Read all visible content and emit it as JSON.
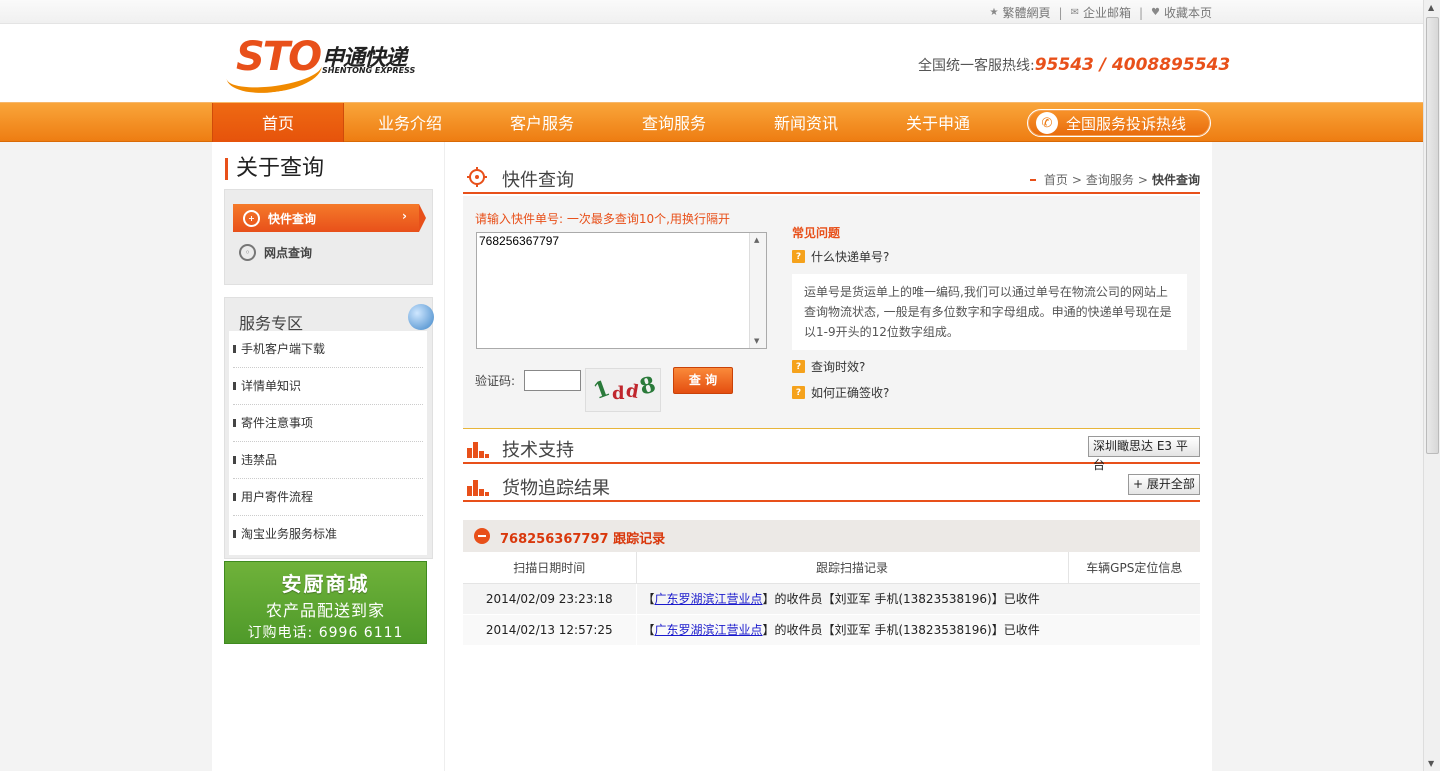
{
  "topbar": {
    "links": [
      {
        "icon": "star-icon",
        "label": "繁體網頁"
      },
      {
        "icon": "mail-icon",
        "label": "企业邮箱"
      },
      {
        "icon": "heart-icon",
        "label": "收藏本页"
      }
    ],
    "separator": "|"
  },
  "header": {
    "logo_mark": "STO",
    "logo_cn": "申通快递",
    "logo_en": "SHENTONG EXPRESS",
    "hotline_label": "全国统一客服热线:",
    "hotline_number": "95543 / 4008895543"
  },
  "nav": {
    "items": [
      "首页",
      "业务介绍",
      "客户服务",
      "查询服务",
      "新闻资讯",
      "关于申通"
    ],
    "complaint_label": "全国服务投诉热线"
  },
  "sidebar": {
    "title": "关于查询",
    "menu": [
      {
        "label": "快件查询",
        "icon": "crosshair-icon",
        "active": true
      },
      {
        "label": "网点查询",
        "icon": "location-icon",
        "active": false
      }
    ],
    "service_title": "服务专区",
    "service_items": [
      "手机客户端下载",
      "详情单知识",
      "寄件注意事项",
      "违禁品",
      "用户寄件流程",
      "淘宝业务服务标准"
    ],
    "ad": {
      "line1": "安厨商城",
      "line2": "农产品配送到家",
      "line3": "订购电话: 6996 6111"
    }
  },
  "main": {
    "section_title": "快件查询",
    "breadcrumb": [
      "首页",
      "查询服务",
      "快件查询"
    ],
    "breadcrumb_sep": ">",
    "query_hint": "请输入快件单号: 一次最多查询10个,用换行隔开",
    "tracking_input": "768256367797",
    "captcha_label": "验证码:",
    "captcha_value": "",
    "captcha_chars": [
      "1",
      "d",
      "d",
      "8"
    ],
    "query_button": "查 询",
    "faq_title": "常见问题",
    "faq": [
      "什么快递单号?",
      "查询时效?",
      "如何正确签收?"
    ],
    "faq_answer": "运单号是货运单上的唯一编码,我们可以通过单号在物流公司的网站上查询物流状态, 一般是有多位数字和字母组成。申通的快递单号现在是以1-9开头的12位数字组成。",
    "tech_title": "技术支持",
    "tech_button": "深圳瞰思达 E3 平台",
    "result_title": "货物追踪结果",
    "expand_button": "+ 展开全部",
    "track_heading": "768256367797 跟踪记录",
    "table_headers": [
      "扫描日期时间",
      "跟踪扫描记录",
      "车辆GPS定位信息"
    ],
    "rows": [
      {
        "datetime": "2014/02/09 23:23:18",
        "pre": "【",
        "link": "广东罗湖滨江营业点",
        "post": "】的收件员【刘亚军 手机(13823538196)】已收件"
      },
      {
        "datetime": "2014/02/13 12:57:25",
        "pre": "【",
        "link": "广东罗湖滨江营业点",
        "post": "】的收件员【刘亚军 手机(13823538196)】已收件"
      }
    ]
  },
  "colors": {
    "brand_orange": "#e8501a",
    "nav_orange": "#f39019",
    "link_blue": "#1a1acc"
  }
}
